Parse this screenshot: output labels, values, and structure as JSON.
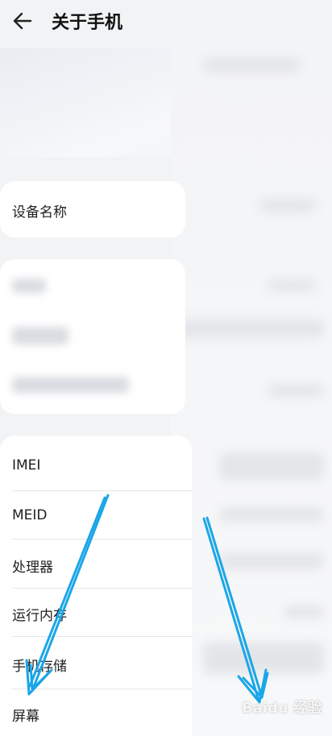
{
  "header": {
    "title": "关于手机"
  },
  "device_name_card": {
    "label": "设备名称"
  },
  "hardware_card": {
    "items": [
      {
        "label": "IMEI"
      },
      {
        "label": "MEID"
      },
      {
        "label": "处理器"
      },
      {
        "label": "运行内存"
      },
      {
        "label": "手机存储"
      },
      {
        "label": "屏幕"
      }
    ]
  },
  "watermark": {
    "text": "Baidu 经验"
  },
  "colors": {
    "background": "#f1f3f5",
    "card": "#ffffff",
    "arrow": "#1aa6e8"
  }
}
